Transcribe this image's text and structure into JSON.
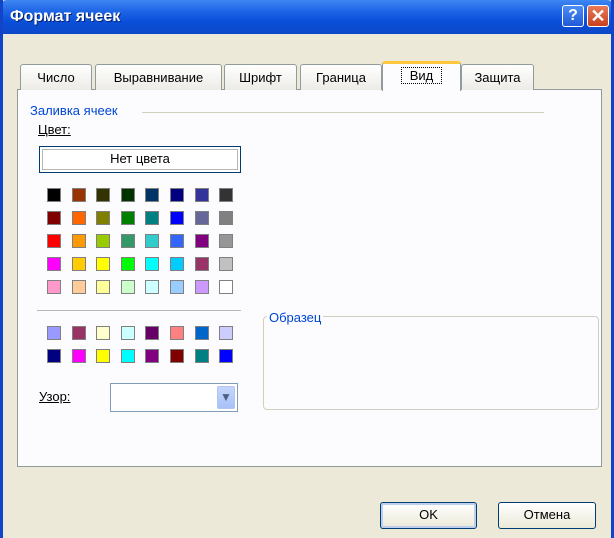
{
  "window": {
    "title": "Формат ячеек",
    "help_icon": "?",
    "close_icon": "✕"
  },
  "tabs": [
    {
      "label": "Число"
    },
    {
      "label": "Выравнивание"
    },
    {
      "label": "Шрифт"
    },
    {
      "label": "Граница"
    },
    {
      "label": "Вид",
      "active": true
    },
    {
      "label": "Защита"
    }
  ],
  "fill": {
    "group_label": "Заливка ячеек",
    "color_label": "Цвет:",
    "no_color_button": "Нет цвета",
    "palette_main": [
      [
        "#000000",
        "#993300",
        "#333300",
        "#003300",
        "#003366",
        "#000080",
        "#333399",
        "#333333"
      ],
      [
        "#800000",
        "#ff6600",
        "#808000",
        "#008000",
        "#008080",
        "#0000ff",
        "#666699",
        "#808080"
      ],
      [
        "#ff0000",
        "#ff9900",
        "#99cc00",
        "#339966",
        "#33cccc",
        "#3366ff",
        "#800080",
        "#969696"
      ],
      [
        "#ff00ff",
        "#ffcc00",
        "#ffff00",
        "#00ff00",
        "#00ffff",
        "#00ccff",
        "#993366",
        "#c0c0c0"
      ],
      [
        "#ff99cc",
        "#ffcc99",
        "#ffff99",
        "#ccffcc",
        "#ccffff",
        "#99ccff",
        "#cc99ff",
        "#ffffff"
      ]
    ],
    "palette_extra": [
      [
        "#9999ff",
        "#993366",
        "#ffffcc",
        "#ccffff",
        "#660066",
        "#ff8080",
        "#0066cc",
        "#ccccff"
      ],
      [
        "#000080",
        "#ff00ff",
        "#ffff00",
        "#00ffff",
        "#800080",
        "#800000",
        "#008080",
        "#0000ff"
      ]
    ],
    "pattern_label": "Узор:",
    "pattern_value": ""
  },
  "sample": {
    "label": "Образец"
  },
  "buttons": {
    "ok": "OK",
    "cancel": "Отмена"
  }
}
